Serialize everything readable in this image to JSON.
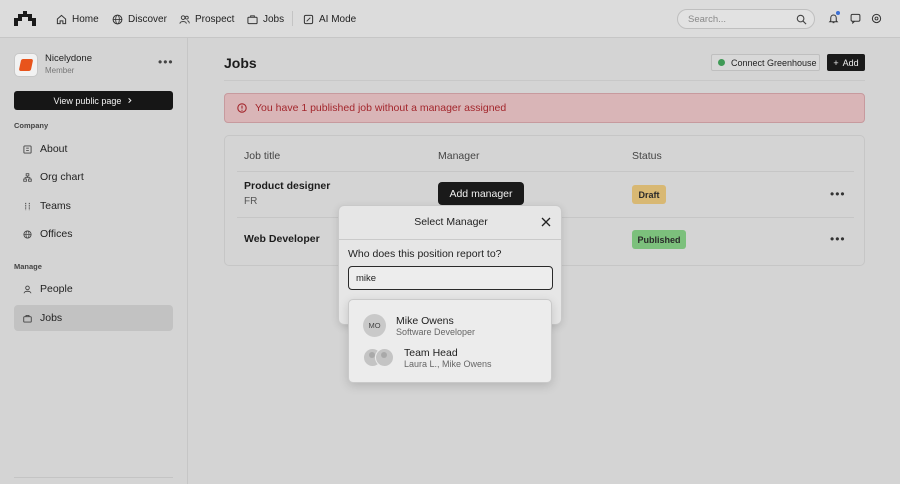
{
  "topnav": {
    "items": [
      {
        "label": "Home",
        "icon": "home-icon"
      },
      {
        "label": "Discover",
        "icon": "globe-icon"
      },
      {
        "label": "Prospect",
        "icon": "users-icon"
      },
      {
        "label": "Jobs",
        "icon": "briefcase-icon"
      },
      {
        "label": "AI Mode",
        "icon": "ai-icon"
      }
    ],
    "search_placeholder": "Search..."
  },
  "sidebar": {
    "org_name": "Nicelydone",
    "org_role": "Member",
    "public_button": "View public page",
    "company_label": "Company",
    "company_items": [
      {
        "label": "About",
        "icon": "building-icon"
      },
      {
        "label": "Org chart",
        "icon": "org-chart-icon"
      },
      {
        "label": "Teams",
        "icon": "teams-icon"
      },
      {
        "label": "Offices",
        "icon": "globe-icon"
      }
    ],
    "manage_label": "Manage",
    "manage_items": [
      {
        "label": "People",
        "icon": "person-icon"
      },
      {
        "label": "Jobs",
        "icon": "briefcase-icon",
        "active": true
      }
    ]
  },
  "main": {
    "title": "Jobs",
    "connect_button": "Connect Greenhouse",
    "add_button": "Add",
    "alert": "You have 1 published job without a manager assigned",
    "table": {
      "headers": [
        "Job title",
        "Manager",
        "Status"
      ],
      "rows": [
        {
          "title": "Product designer",
          "location": "FR",
          "manager_button": "Add manager",
          "status": "Draft",
          "status_color": "#d8b873"
        },
        {
          "title": "Web Developer",
          "location": "",
          "manager_button": "",
          "status": "Published",
          "status_color": "#7cc07c"
        }
      ]
    }
  },
  "modal": {
    "title": "Select Manager",
    "question": "Who does this position report to?",
    "input_value": "mike",
    "options": [
      {
        "initials": "MO",
        "name": "Mike Owens",
        "subtitle": "Software Developer"
      },
      {
        "name": "Team Head",
        "subtitle": "Laura L., Mike Owens"
      }
    ]
  }
}
